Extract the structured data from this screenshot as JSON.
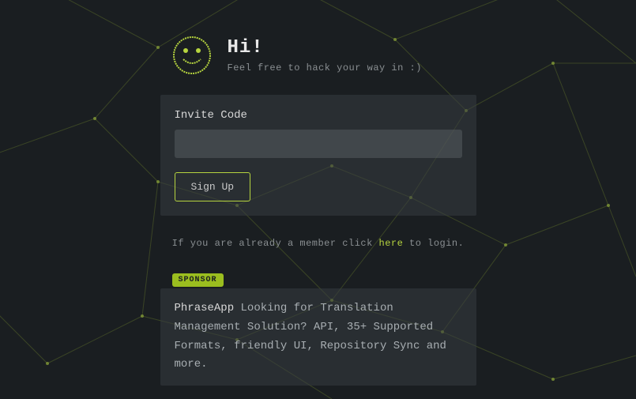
{
  "header": {
    "greeting": "Hi!",
    "subtitle": "Feel free to hack your way in :)"
  },
  "form": {
    "label": "Invite Code",
    "input_value": "",
    "button": "Sign Up"
  },
  "member": {
    "prefix": "If you are already a member click ",
    "link": "here",
    "suffix": " to login."
  },
  "sponsor": {
    "badge": "SPONSOR",
    "name": "PhraseApp",
    "text": " Looking for Translation Management Solution? API, 35+ Supported Formats, friendly UI, Repository Sync and more."
  },
  "colors": {
    "accent": "#b6d43f",
    "bg": "#1a1e21"
  }
}
